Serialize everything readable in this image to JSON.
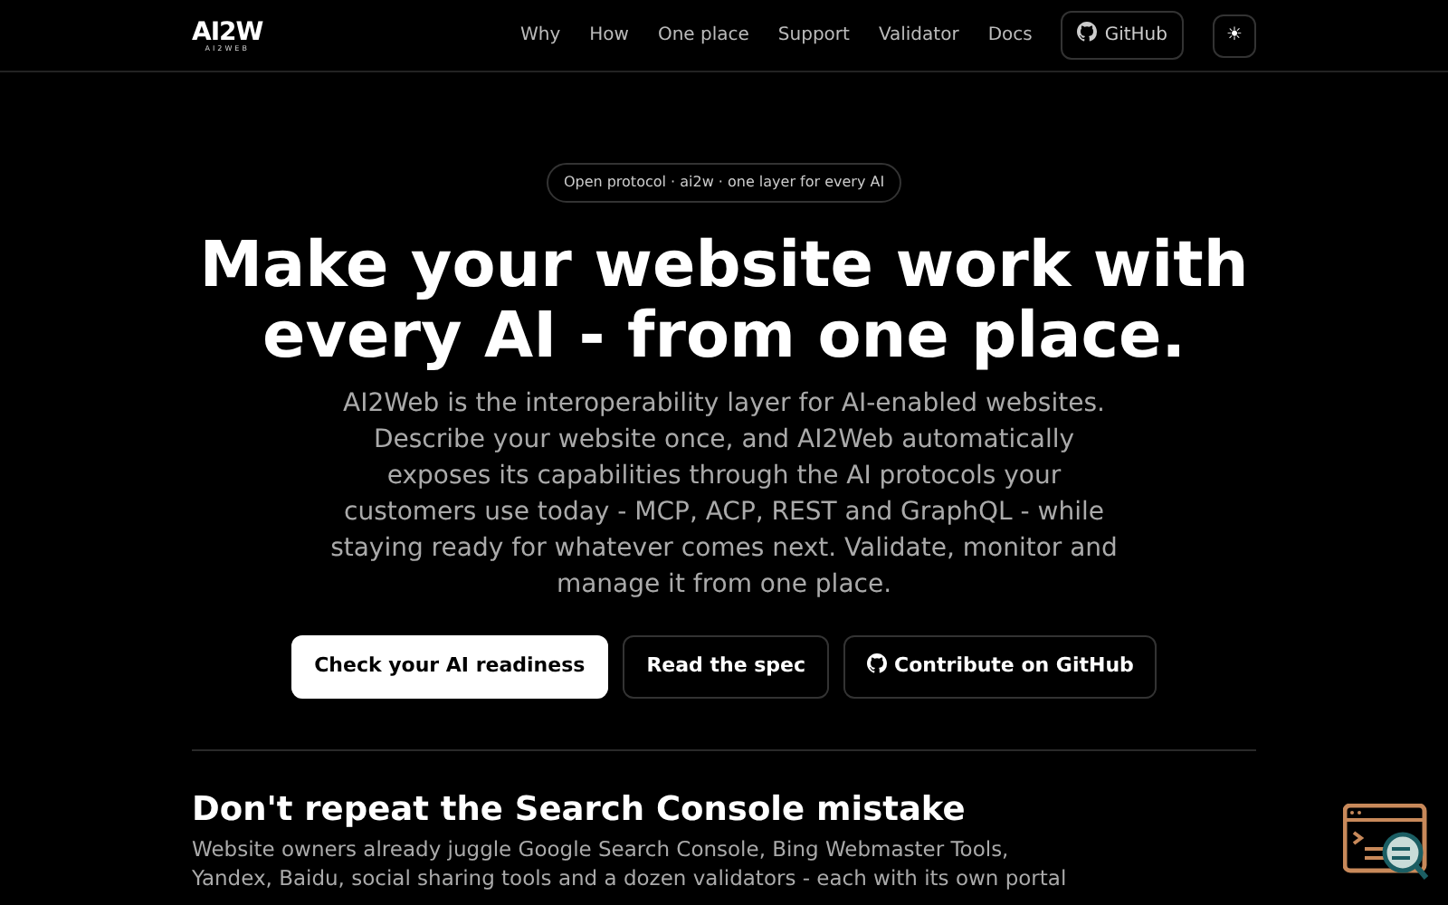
{
  "logo": {
    "mark": "AI2W",
    "subtitle": "AI2WEB"
  },
  "nav": {
    "links": [
      "Why",
      "How",
      "One place",
      "Support",
      "Validator",
      "Docs"
    ],
    "github": "GitHub",
    "theme_toggle": "☀"
  },
  "hero": {
    "badge": "Open protocol · ai2w · one layer for every AI",
    "title": "Make your website work with every AI - from one place.",
    "lead": "AI2Web is the interoperability layer for AI-enabled websites. Describe your website once, and AI2Web automatically exposes its capabilities through the AI protocols your customers use today - MCP, ACP, REST and GraphQL - while staying ready for whatever comes next. Validate, monitor and manage it from one place.",
    "buttons": [
      {
        "label": "Check your AI readiness",
        "kind": "primary"
      },
      {
        "label": "Read the spec",
        "kind": "outline"
      },
      {
        "label": "Contribute on GitHub",
        "kind": "github"
      }
    ]
  },
  "section": {
    "title": "Don't repeat the Search Console mistake",
    "text": "Website owners already juggle Google Search Console, Bing Webmaster Tools, Yandex, Baidu, social sharing tools and a dozen validators - each with its own portal"
  }
}
